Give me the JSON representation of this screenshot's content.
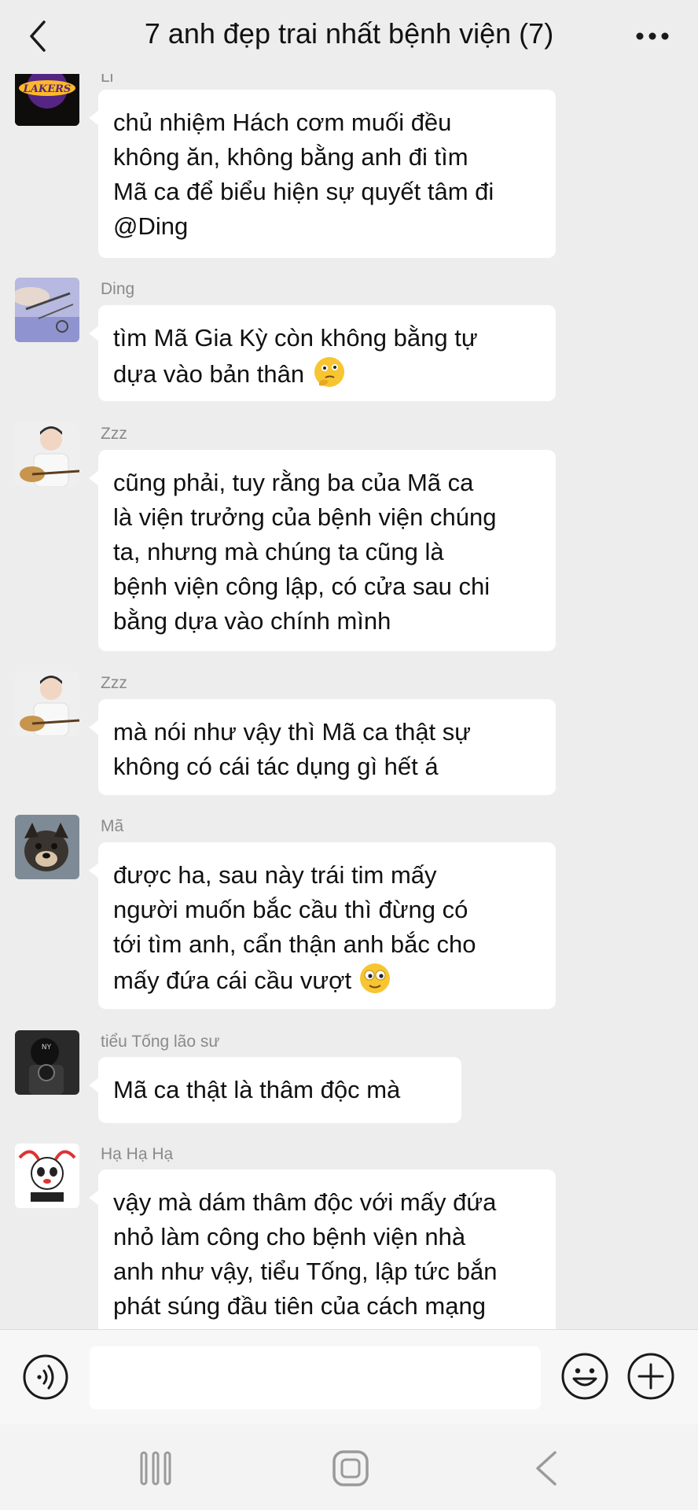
{
  "header": {
    "title": "7 anh đẹp trai nhất bệnh viện (7)",
    "back_icon": "chevron-left-icon",
    "more_icon": "more-dots-icon"
  },
  "messages": [
    {
      "sender": "Li",
      "avatar": "lakers-logo-avatar",
      "lines": [
        "chủ nhiệm Hách cơm muối đều",
        "không ăn, không bằng anh đi tìm",
        "Mã ca để biểu hiện sự quyết tâm đi",
        "@Ding"
      ]
    },
    {
      "sender": "Ding",
      "avatar": "surgical-tools-avatar",
      "lines": [
        "tìm Mã Gia Kỳ còn không bằng tự",
        "dựa vào bản thân"
      ],
      "emoji": "thinking-emoji"
    },
    {
      "sender": "Zzz",
      "avatar": "guitar-boy-avatar",
      "lines": [
        "cũng phải, tuy rằng ba của Mã ca",
        "là viện trưởng của bệnh viện chúng",
        "ta, nhưng mà chúng ta cũng là",
        "bệnh viện công lập, có cửa sau chi",
        "bằng dựa vào chính mình"
      ]
    },
    {
      "sender": "Zzz",
      "avatar": "guitar-boy-avatar",
      "lines": [
        "mà nói như vậy thì Mã ca thật sự",
        "không có cái tác dụng gì hết á"
      ]
    },
    {
      "sender": "Mã",
      "avatar": "dog-avatar",
      "lines": [
        "được ha, sau này trái tim mấy",
        "người muốn bắc cầu thì đừng có",
        "tới tìm anh, cẩn thận anh bắc cho",
        "mấy đứa cái cầu vượt"
      ],
      "emoji": "wide-eyed-emoji"
    },
    {
      "sender": "tiểu Tống lão sư",
      "avatar": "camera-person-avatar",
      "lines": [
        "Mã ca thật là thâm độc mà"
      ]
    },
    {
      "sender": "Hạ Hạ Hạ",
      "avatar": "cartoon-panda-avatar",
      "lines": [
        "vậy mà dám thâm độc với mấy đứa",
        "nhỏ làm công cho bệnh viện nhà",
        "anh như vậy, tiểu Tống, lập tức bắn",
        "phát súng đầu tiên của cách mạng"
      ]
    }
  ],
  "input_bar": {
    "voice_icon": "voice-input-icon",
    "text_value": "",
    "emoji_icon": "smiley-icon",
    "plus_icon": "plus-circle-icon"
  },
  "nav_bar": {
    "recent_icon": "recent-apps-icon",
    "home_icon": "home-icon",
    "back_icon": "nav-back-icon"
  },
  "colors": {
    "background": "#ededed",
    "bubble": "#ffffff",
    "sender_text": "#8a8a8a"
  }
}
